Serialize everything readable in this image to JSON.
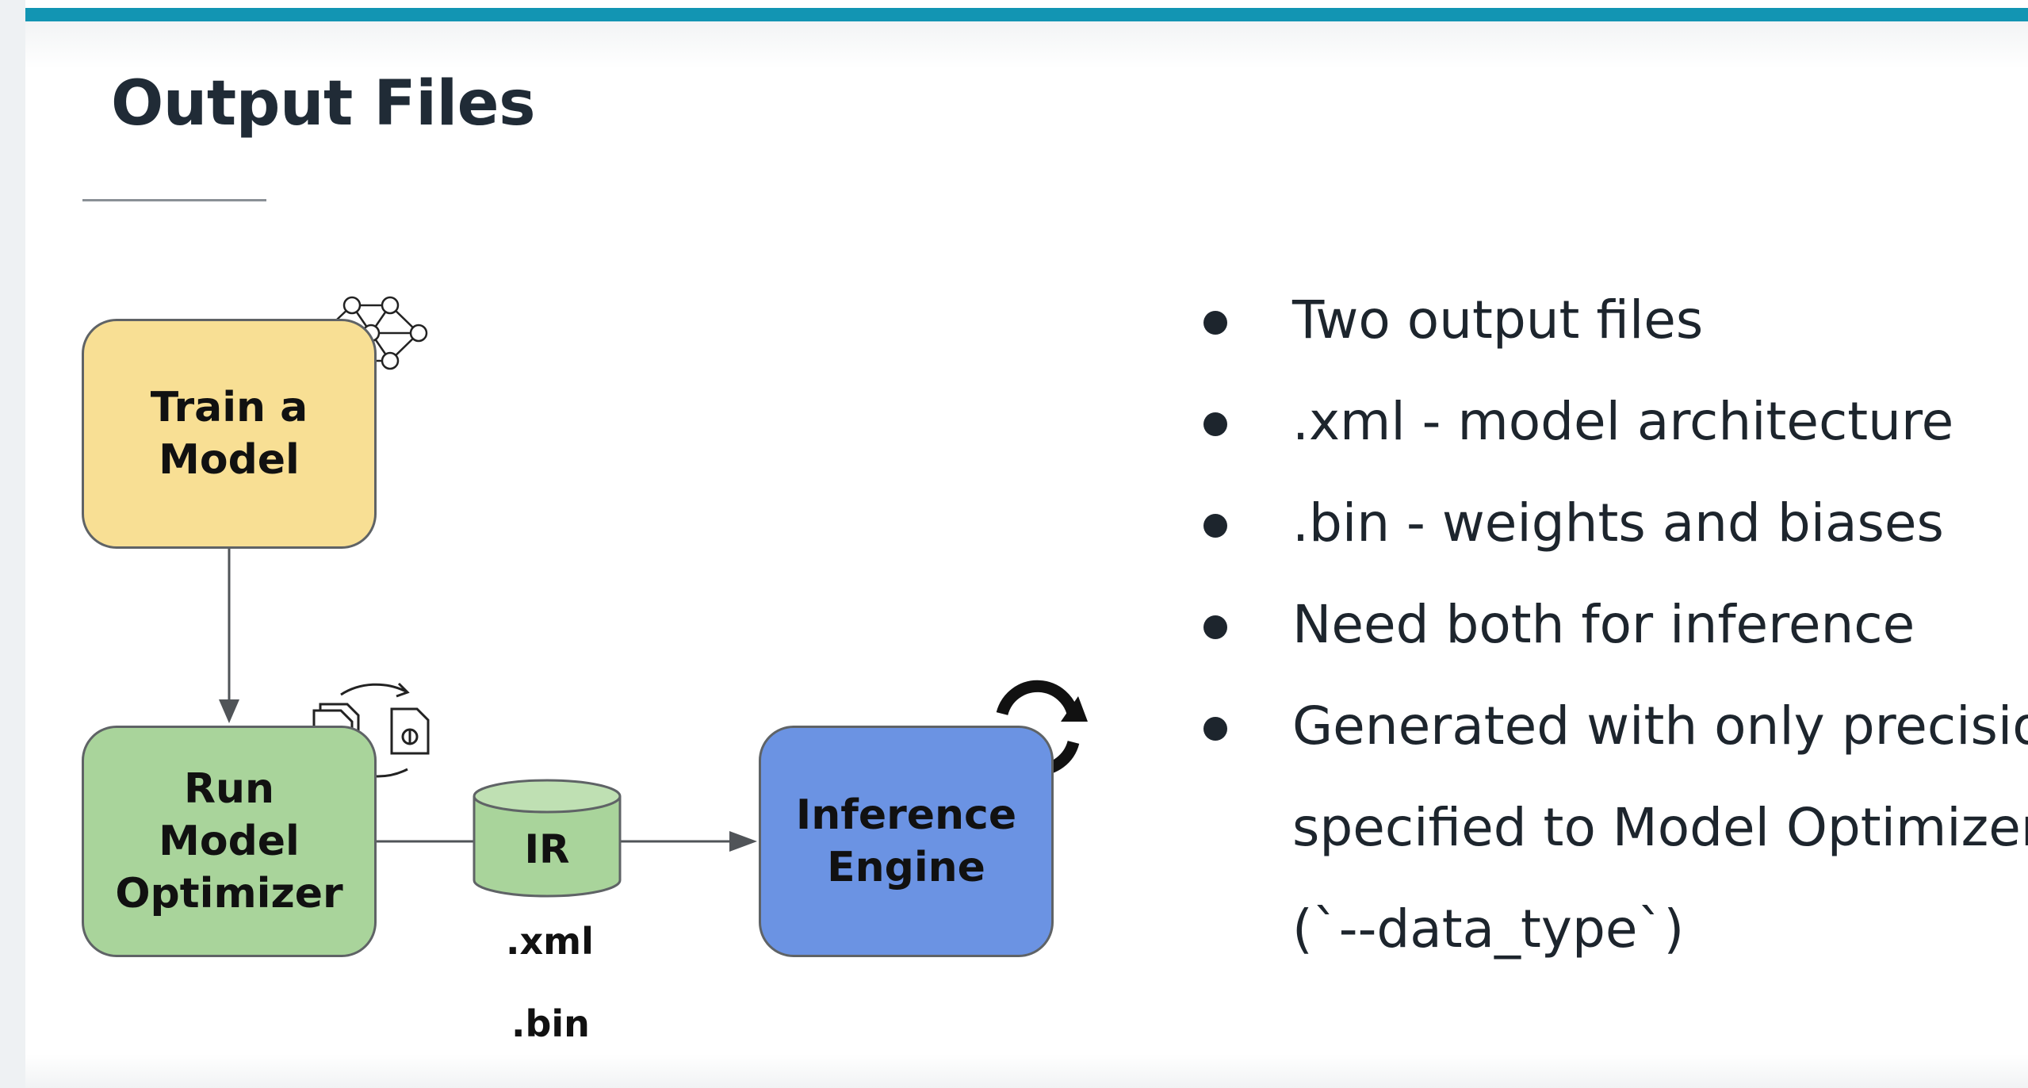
{
  "slide": {
    "title": "Output Files"
  },
  "diagram": {
    "train_box": {
      "line1": "Train a",
      "line2": "Model"
    },
    "optimizer_box": {
      "line1": "Run",
      "line2": "Model",
      "line3": "Optimizer"
    },
    "inference_box": {
      "line1": "Inference",
      "line2": "Engine"
    },
    "ir_label": "IR",
    "file_xml": ".xml",
    "file_bin": ".bin"
  },
  "bullets": [
    "Two output files",
    ".xml - model architecture",
    ".bin - weights and biases",
    "Need both for inference",
    "Generated with only precision specified to Model Optimizer (`--data_type`)"
  ],
  "colors": {
    "header_bar": "#1295b3",
    "train_box": "#f8df94",
    "optimizer_box": "#a9d49b",
    "inference_box": "#6b93e3",
    "ir_cylinder": "#a9d49b"
  },
  "icons": [
    "neural-network-icon",
    "convert-files-icon",
    "refresh-icon"
  ]
}
